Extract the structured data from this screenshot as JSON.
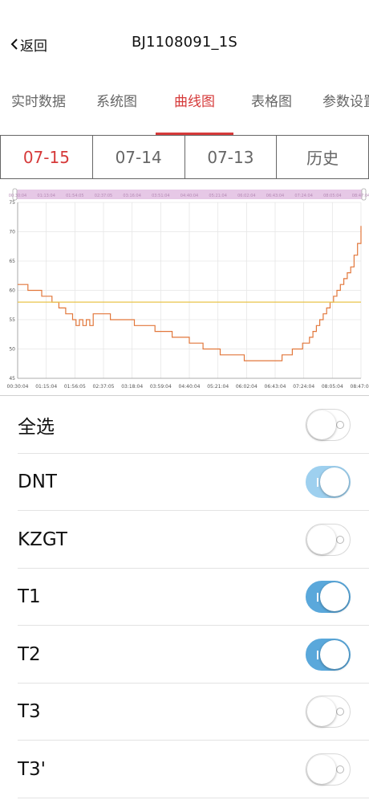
{
  "nav": {
    "back_label": "返回",
    "title": "BJ1108091_1S"
  },
  "tabs": [
    {
      "label": "实时数据"
    },
    {
      "label": "系统图"
    },
    {
      "label": "曲线图",
      "active": true
    },
    {
      "label": "表格图"
    },
    {
      "label": "参数设置"
    }
  ],
  "dates": [
    {
      "label": "07-15",
      "active": true
    },
    {
      "label": "07-14"
    },
    {
      "label": "07-13"
    },
    {
      "label": "历史"
    }
  ],
  "colors": {
    "accent": "#d63a3a",
    "series_orange": "#e2773b",
    "series_yellow": "#e8c44a",
    "switch_on": "#5aa8db",
    "zoom_bar": "#e6c8e6"
  },
  "chart_data": {
    "type": "line",
    "ylim": [
      45,
      75
    ],
    "yticks": [
      "75",
      "70",
      "65",
      "60",
      "55",
      "50",
      "45"
    ],
    "xticks": [
      "00:30:04",
      "01:15:04",
      "01:56:05",
      "02:37:05",
      "03:18:04",
      "03:59:04",
      "04:40:04",
      "05:21:04",
      "06:02:04",
      "06:43:04",
      "07:24:04",
      "08:05:04",
      "08:47:04"
    ],
    "zoom_labels": [
      "00:30:04",
      "01:13:04",
      "01:54:05",
      "02:37:05",
      "03:16:04",
      "03:51:04",
      "04:40:04",
      "05:21:04",
      "06:02:04",
      "06:43:04",
      "07:24:04",
      "08:05:04",
      "08:47:04"
    ],
    "grid": true,
    "series": [
      {
        "color": "#e2773b",
        "points": [
          [
            0.0,
            61
          ],
          [
            0.03,
            61
          ],
          [
            0.03,
            60
          ],
          [
            0.07,
            60
          ],
          [
            0.07,
            59
          ],
          [
            0.1,
            59
          ],
          [
            0.1,
            58
          ],
          [
            0.12,
            58
          ],
          [
            0.12,
            57
          ],
          [
            0.14,
            57
          ],
          [
            0.14,
            56
          ],
          [
            0.16,
            56
          ],
          [
            0.16,
            55
          ],
          [
            0.17,
            55
          ],
          [
            0.17,
            54
          ],
          [
            0.18,
            54
          ],
          [
            0.18,
            55
          ],
          [
            0.19,
            55
          ],
          [
            0.19,
            54
          ],
          [
            0.2,
            54
          ],
          [
            0.2,
            55
          ],
          [
            0.21,
            55
          ],
          [
            0.21,
            54
          ],
          [
            0.22,
            54
          ],
          [
            0.22,
            56
          ],
          [
            0.27,
            56
          ],
          [
            0.27,
            55
          ],
          [
            0.34,
            55
          ],
          [
            0.34,
            54
          ],
          [
            0.4,
            54
          ],
          [
            0.4,
            53
          ],
          [
            0.45,
            53
          ],
          [
            0.45,
            52
          ],
          [
            0.5,
            52
          ],
          [
            0.5,
            51
          ],
          [
            0.54,
            51
          ],
          [
            0.54,
            50
          ],
          [
            0.59,
            50
          ],
          [
            0.59,
            49
          ],
          [
            0.66,
            49
          ],
          [
            0.66,
            48
          ],
          [
            0.77,
            48
          ],
          [
            0.77,
            49
          ],
          [
            0.8,
            49
          ],
          [
            0.8,
            50
          ],
          [
            0.83,
            50
          ],
          [
            0.83,
            51
          ],
          [
            0.85,
            51
          ],
          [
            0.85,
            52
          ],
          [
            0.86,
            52
          ],
          [
            0.86,
            53
          ],
          [
            0.87,
            53
          ],
          [
            0.87,
            54
          ],
          [
            0.88,
            54
          ],
          [
            0.88,
            55
          ],
          [
            0.89,
            55
          ],
          [
            0.89,
            56
          ],
          [
            0.9,
            56
          ],
          [
            0.9,
            57
          ],
          [
            0.91,
            57
          ],
          [
            0.91,
            58
          ],
          [
            0.92,
            58
          ],
          [
            0.92,
            59
          ],
          [
            0.93,
            59
          ],
          [
            0.93,
            60
          ],
          [
            0.94,
            60
          ],
          [
            0.94,
            61
          ],
          [
            0.95,
            61
          ],
          [
            0.95,
            62
          ],
          [
            0.96,
            62
          ],
          [
            0.96,
            63
          ],
          [
            0.97,
            63
          ],
          [
            0.97,
            64
          ],
          [
            0.98,
            64
          ],
          [
            0.98,
            66
          ],
          [
            0.99,
            66
          ],
          [
            0.99,
            68
          ],
          [
            1.0,
            68
          ],
          [
            1.0,
            71
          ]
        ]
      },
      {
        "color": "#e8c44a",
        "points": [
          [
            0.0,
            58
          ],
          [
            1.0,
            58
          ]
        ]
      }
    ]
  },
  "toggles": [
    {
      "label": "全选",
      "on": false
    },
    {
      "label": "DNT",
      "on": true,
      "light": true
    },
    {
      "label": "KZGT",
      "on": false
    },
    {
      "label": "T1",
      "on": true
    },
    {
      "label": "T2",
      "on": true
    },
    {
      "label": "T3",
      "on": false
    },
    {
      "label": "T3'",
      "on": false
    }
  ]
}
